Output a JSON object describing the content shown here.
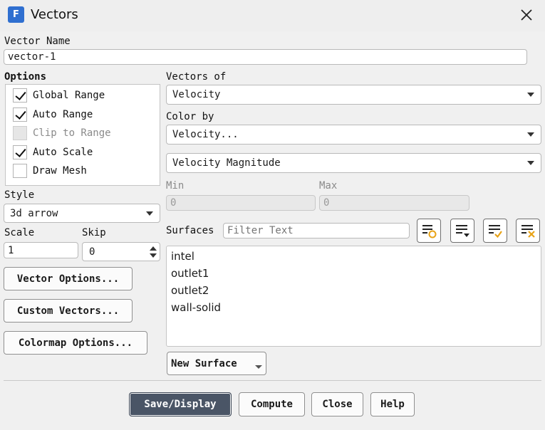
{
  "window": {
    "title": "Vectors",
    "app_icon_letter": "F"
  },
  "vector_name": {
    "label": "Vector Name",
    "value": "vector-1"
  },
  "options": {
    "label": "Options",
    "items": [
      {
        "label": "Global Range",
        "checked": true,
        "enabled": true
      },
      {
        "label": "Auto Range",
        "checked": true,
        "enabled": true
      },
      {
        "label": "Clip to Range",
        "checked": false,
        "enabled": false
      },
      {
        "label": "Auto Scale",
        "checked": true,
        "enabled": true
      },
      {
        "label": "Draw Mesh",
        "checked": false,
        "enabled": true
      }
    ]
  },
  "style": {
    "label": "Style",
    "value": "3d arrow"
  },
  "scale": {
    "label": "Scale",
    "value": "1"
  },
  "skip": {
    "label": "Skip",
    "value": "0"
  },
  "left_buttons": {
    "vector_options": "Vector Options...",
    "custom_vectors": "Custom Vectors...",
    "colormap_options": "Colormap Options..."
  },
  "vectors_of": {
    "label": "Vectors of",
    "value": "Velocity"
  },
  "color_by": {
    "label": "Color by",
    "value": "Velocity...",
    "sub_value": "Velocity Magnitude"
  },
  "min": {
    "label": "Min",
    "value": "0"
  },
  "max": {
    "label": "Max",
    "value": "0"
  },
  "surfaces": {
    "label": "Surfaces",
    "filter_placeholder": "Filter Text",
    "items": [
      "intel",
      "outlet1",
      "outlet2",
      "wall-solid"
    ],
    "new_surface_label": "New Surface"
  },
  "footer": {
    "save_display": "Save/Display",
    "compute": "Compute",
    "close": "Close",
    "help": "Help"
  }
}
